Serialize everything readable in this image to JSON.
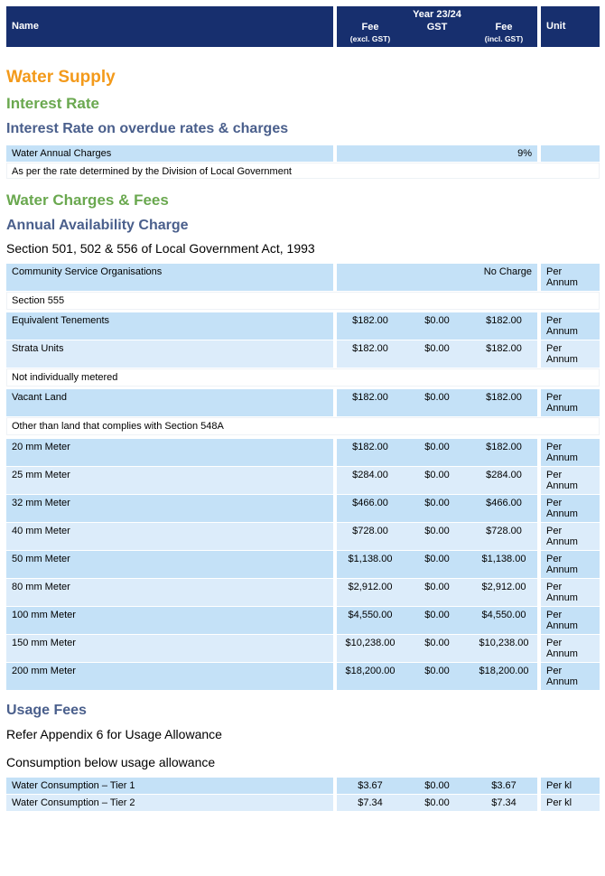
{
  "header": {
    "name": "Name",
    "year": "Year 23/24",
    "fee_excl": "Fee",
    "fee_excl_sub": "(excl. GST)",
    "gst": "GST",
    "fee_incl": "Fee",
    "fee_incl_sub": "(incl. GST)",
    "unit": "Unit"
  },
  "section_title": "Water Supply",
  "interest": {
    "heading": "Interest Rate",
    "subheading": "Interest Rate on overdue rates & charges",
    "row": {
      "name": "Water Annual Charges",
      "value": "9%"
    },
    "note": "As per the rate determined by the Division of Local Government"
  },
  "charges": {
    "heading": "Water Charges & Fees",
    "subheading": "Annual Availability Charge",
    "act": "Section 501, 502 & 556 of Local Government Act, 1993",
    "cso": {
      "name": "Community Service Organisations",
      "value": "No Charge",
      "unit_1": "Per",
      "unit_2": "Annum"
    },
    "note_555": "Section 555",
    "equivalent": {
      "name": "Equivalent Tenements",
      "excl": "$182.00",
      "gst": "$0.00",
      "incl": "$182.00",
      "unit_1": "Per",
      "unit_2": "Annum"
    },
    "strata": {
      "name": "Strata Units",
      "excl": "$182.00",
      "gst": "$0.00",
      "incl": "$182.00",
      "unit_1": "Per",
      "unit_2": "Annum"
    },
    "note_metered": "Not individually metered",
    "vacant": {
      "name": "Vacant Land",
      "excl": "$182.00",
      "gst": "$0.00",
      "incl": "$182.00",
      "unit_1": "Per",
      "unit_2": "Annum"
    },
    "note_548a": "Other than land that complies with Section 548A",
    "meters": [
      {
        "name": "20 mm Meter",
        "excl": "$182.00",
        "gst": "$0.00",
        "incl": "$182.00",
        "unit_1": "Per",
        "unit_2": "Annum"
      },
      {
        "name": "25 mm Meter",
        "excl": "$284.00",
        "gst": "$0.00",
        "incl": "$284.00",
        "unit_1": "Per",
        "unit_2": "Annum"
      },
      {
        "name": "32 mm Meter",
        "excl": "$466.00",
        "gst": "$0.00",
        "incl": "$466.00",
        "unit_1": "Per",
        "unit_2": "Annum"
      },
      {
        "name": "40 mm Meter",
        "excl": "$728.00",
        "gst": "$0.00",
        "incl": "$728.00",
        "unit_1": "Per",
        "unit_2": "Annum"
      },
      {
        "name": "50 mm Meter",
        "excl": "$1,138.00",
        "gst": "$0.00",
        "incl": "$1,138.00",
        "unit_1": "Per",
        "unit_2": "Annum"
      },
      {
        "name": "80 mm Meter",
        "excl": "$2,912.00",
        "gst": "$0.00",
        "incl": "$2,912.00",
        "unit_1": "Per",
        "unit_2": "Annum"
      },
      {
        "name": "100 mm Meter",
        "excl": "$4,550.00",
        "gst": "$0.00",
        "incl": "$4,550.00",
        "unit_1": "Per",
        "unit_2": "Annum"
      },
      {
        "name": "150 mm Meter",
        "excl": "$10,238.00",
        "gst": "$0.00",
        "incl": "$10,238.00",
        "unit_1": "Per",
        "unit_2": "Annum"
      },
      {
        "name": "200 mm Meter",
        "excl": "$18,200.00",
        "gst": "$0.00",
        "incl": "$18,200.00",
        "unit_1": "Per",
        "unit_2": "Annum"
      }
    ]
  },
  "usage": {
    "heading": "Usage Fees",
    "ref": "Refer Appendix 6 for Usage Allowance",
    "below": "Consumption below usage allowance",
    "tiers": [
      {
        "name": "Water Consumption – Tier 1",
        "excl": "$3.67",
        "gst": "$0.00",
        "incl": "$3.67",
        "unit": "Per kl"
      },
      {
        "name": "Water Consumption – Tier 2",
        "excl": "$7.34",
        "gst": "$0.00",
        "incl": "$7.34",
        "unit": "Per kl"
      }
    ]
  }
}
